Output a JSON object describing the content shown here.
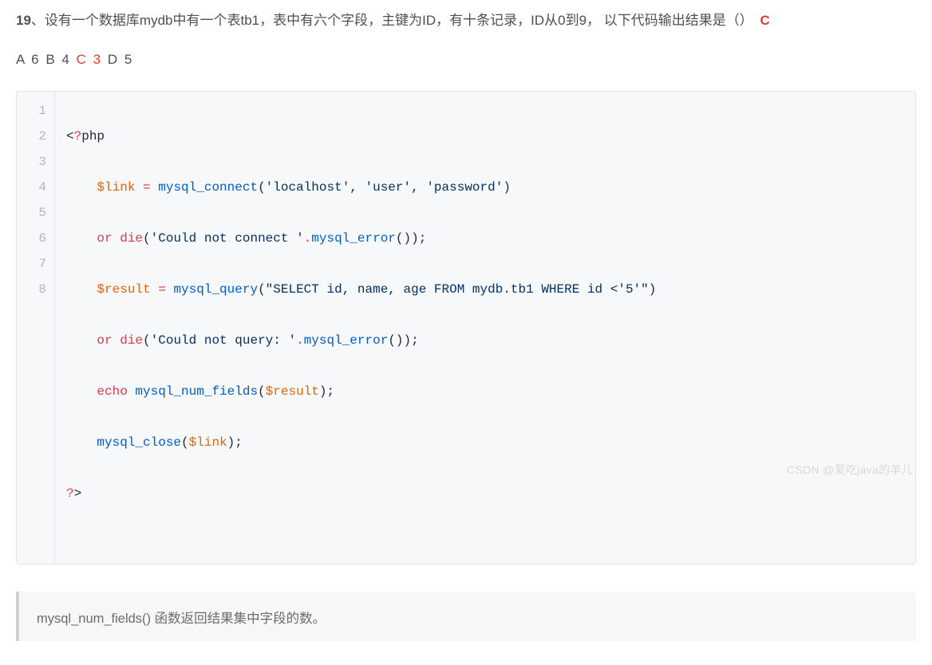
{
  "question": {
    "number": "19",
    "sep": "、",
    "text_line1": "设有一个数据库mydb中有一个表tb1，表中有六个字段，主键为ID，有十条记录，ID从0到9， 以下代码输出结果是（）",
    "answer": "C"
  },
  "options": {
    "a_label": "A",
    "a_val": "6",
    "b_label": "B",
    "b_val": "4",
    "c_label": "C",
    "c_val": "3",
    "d_label": "D",
    "d_val": "5"
  },
  "code": {
    "line_numbers": [
      "1",
      "2",
      "3",
      "4",
      "5",
      "6",
      "7",
      "8"
    ],
    "l1": {
      "open": "<",
      "q": "?",
      "php": "php"
    },
    "l2": {
      "indent": "    ",
      "var1": "$link",
      "eq": " = ",
      "fn": "mysql_connect",
      "lp": "(",
      "s1": "'localhost'",
      "c1": ", ",
      "s2": "'user'",
      "c2": ", ",
      "s3": "'password'",
      "rp": ")"
    },
    "l3": {
      "indent": "    ",
      "kw1": "or",
      "sp1": " ",
      "kw2": "die",
      "lp": "(",
      "s1": "'Could not connect '",
      "dot": ".",
      "fn": "mysql_error",
      "lp2": "(",
      "rp2": ")",
      "rp": ")",
      "semi": ";"
    },
    "l4": {
      "indent": "    ",
      "var1": "$result",
      "eq": " = ",
      "fn": "mysql_query",
      "lp": "(",
      "s1": "\"SELECT id, name, age FROM mydb.tb1 WHERE id <'5'\"",
      "rp": ")"
    },
    "l5": {
      "indent": "    ",
      "kw1": "or",
      "sp1": " ",
      "kw2": "die",
      "lp": "(",
      "s1": "'Could not query: '",
      "dot": ".",
      "fn": "mysql_error",
      "lp2": "(",
      "rp2": ")",
      "rp": ")",
      "semi": ";"
    },
    "l6": {
      "indent": "    ",
      "kw1": "echo",
      "sp": " ",
      "fn": "mysql_num_fields",
      "lp": "(",
      "var1": "$result",
      "rp": ")",
      "semi": ";"
    },
    "l7": {
      "indent": "    ",
      "fn": "mysql_close",
      "lp": "(",
      "var1": "$link",
      "rp": ")",
      "semi": ";"
    },
    "l8": {
      "q": "?",
      "close": ">"
    }
  },
  "explanation": "mysql_num_fields() 函数返回结果集中字段的数。",
  "watermark": "CSDN @爱吃java的羊儿"
}
